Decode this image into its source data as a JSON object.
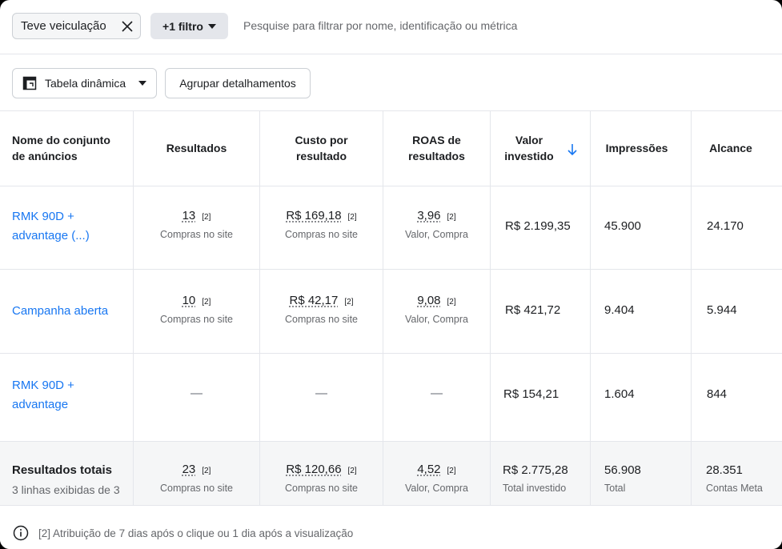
{
  "filters": {
    "active_chip": "Teve veiculação",
    "more_filters": "+1 filtro",
    "search_placeholder": "Pesquise para filtrar por nome, identificação ou métrica"
  },
  "toolbar": {
    "pivot_label": "Tabela dinâmica",
    "group_label": "Agrupar detalhamentos"
  },
  "table": {
    "headers": {
      "name": [
        "Nome do conjunto",
        "de anúncios"
      ],
      "results": "Resultados",
      "cost": [
        "Custo por",
        "resultado"
      ],
      "roas": [
        "ROAS de",
        "resultados"
      ],
      "spent": [
        "Valor",
        "investido"
      ],
      "impressions": "Impressões",
      "reach": "Alcance"
    },
    "rows": [
      {
        "name": [
          "RMK 90D +",
          "advantage (...)"
        ],
        "results": {
          "value": "13",
          "ref": "[2]",
          "sub": "Compras no site"
        },
        "cost": {
          "value": "R$ 169,18",
          "ref": "[2]",
          "sub": "Compras no site"
        },
        "roas": {
          "value": "3,96",
          "ref": "[2]",
          "sub": "Valor, Compra"
        },
        "spent": "R$ 2.199,35",
        "impressions": "45.900",
        "reach": "24.170"
      },
      {
        "name": [
          "Campanha aberta"
        ],
        "results": {
          "value": "10",
          "ref": "[2]",
          "sub": "Compras no site"
        },
        "cost": {
          "value": "R$ 42,17",
          "ref": "[2]",
          "sub": "Compras no site"
        },
        "roas": {
          "value": "9,08",
          "ref": "[2]",
          "sub": "Valor, Compra"
        },
        "spent": "R$ 421,72",
        "impressions": "9.404",
        "reach": "5.944"
      },
      {
        "name": [
          "RMK 90D +",
          "advantage"
        ],
        "results": "—",
        "cost": "—",
        "roas": "—",
        "spent": "R$ 154,21",
        "impressions": "1.604",
        "reach": "844"
      }
    ],
    "totals": {
      "title": "Resultados totais",
      "subtitle": "3 linhas exibidas de 3",
      "results": {
        "value": "23",
        "ref": "[2]",
        "sub": "Compras no site"
      },
      "cost": {
        "value": "R$ 120,66",
        "ref": "[2]",
        "sub": "Compras no site"
      },
      "roas": {
        "value": "4,52",
        "ref": "[2]",
        "sub": "Valor, Compra"
      },
      "spent": {
        "value": "R$ 2.775,28",
        "sub": "Total investido"
      },
      "impressions": {
        "value": "56.908",
        "sub": "Total"
      },
      "reach": {
        "value": "28.351",
        "sub": "Contas Meta"
      }
    }
  },
  "footer": {
    "note": "[2] Atribuição de 7 dias após o clique ou 1 dia após a visualização"
  },
  "icons": {
    "close": "close-icon",
    "caret": "caret-down-icon",
    "pivot": "pivot-table-icon",
    "sort": "arrow-down-icon",
    "info": "info-icon"
  },
  "colors": {
    "link": "#1877f2",
    "totals_bg": "#f5f6f7",
    "muted": "#65676b"
  }
}
